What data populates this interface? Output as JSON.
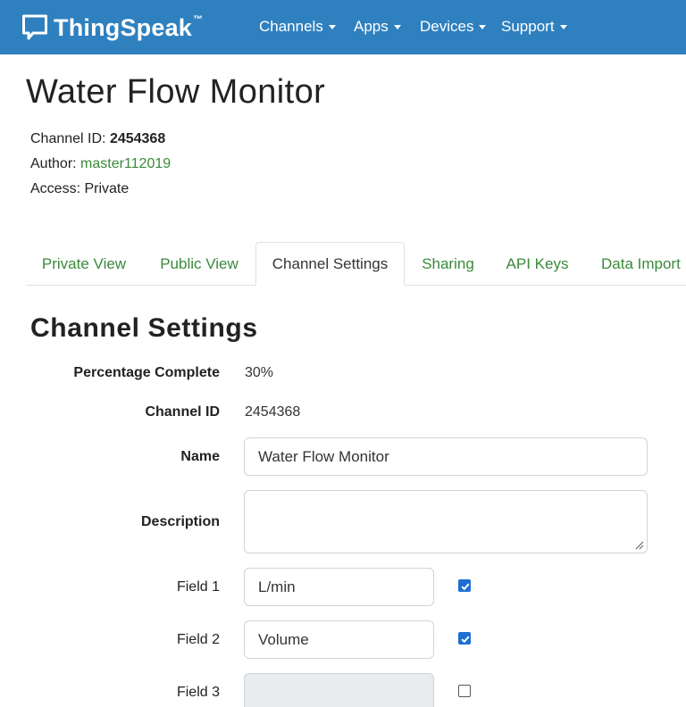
{
  "navbar": {
    "brand": "ThingSpeak",
    "brand_tm": "™",
    "brand_color": "#2f80bf",
    "items": [
      {
        "label": "Channels"
      },
      {
        "label": "Apps"
      },
      {
        "label": "Devices"
      },
      {
        "label": "Support"
      }
    ]
  },
  "header": {
    "title": "Water Flow Monitor",
    "channel_id_label": "Channel ID: ",
    "channel_id": "2454368",
    "author_label": "Author: ",
    "author": "master112019",
    "access": "Access: Private"
  },
  "tabs": [
    {
      "label": "Private View",
      "active": false
    },
    {
      "label": "Public View",
      "active": false
    },
    {
      "label": "Channel Settings",
      "active": true
    },
    {
      "label": "Sharing",
      "active": false
    },
    {
      "label": "API Keys",
      "active": false
    },
    {
      "label": "Data Import",
      "active": false
    }
  ],
  "settings": {
    "title": "Channel Settings",
    "percentage_label": "Percentage Complete",
    "percentage_value": "30%",
    "channel_id_label": "Channel ID",
    "channel_id_value": "2454368",
    "name_label": "Name",
    "name_value": "Water Flow Monitor",
    "description_label": "Description",
    "description_value": "",
    "fields": [
      {
        "label": "Field 1",
        "value": "L/min",
        "checked": true
      },
      {
        "label": "Field 2",
        "value": "Volume",
        "checked": true
      },
      {
        "label": "Field 3",
        "value": "",
        "checked": false
      }
    ]
  },
  "colors": {
    "link_green": "#3a8a3a",
    "checkbox_blue": "#1f6fd1"
  }
}
